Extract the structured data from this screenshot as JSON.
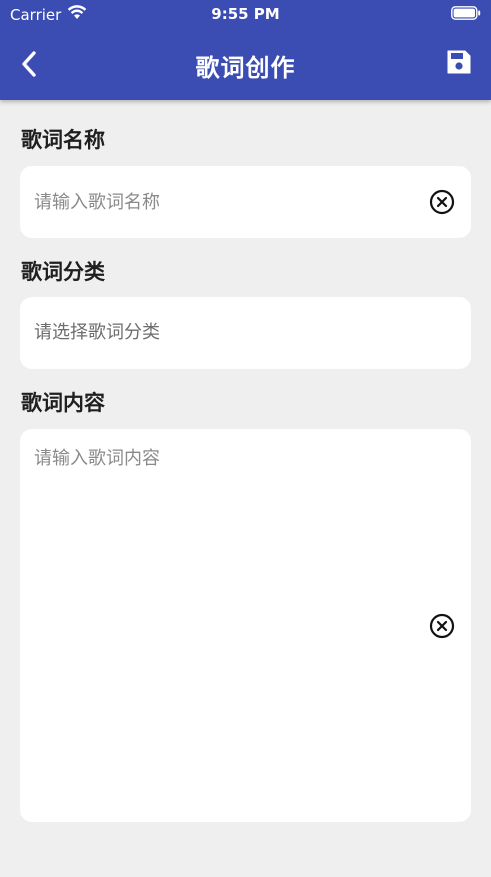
{
  "status_bar": {
    "carrier": "Carrier",
    "time": "9:55 PM"
  },
  "nav": {
    "title": "歌词创作",
    "back_icon": "chevron-left-icon",
    "save_icon": "save-icon"
  },
  "form": {
    "name": {
      "label": "歌词名称",
      "placeholder": "请输入歌词名称",
      "value": ""
    },
    "category": {
      "label": "歌词分类",
      "placeholder": "请选择歌词分类"
    },
    "content": {
      "label": "歌词内容",
      "placeholder": "请输入歌词内容",
      "value": ""
    }
  },
  "colors": {
    "primary": "#3b4db3",
    "background": "#efefef",
    "card": "#ffffff"
  }
}
